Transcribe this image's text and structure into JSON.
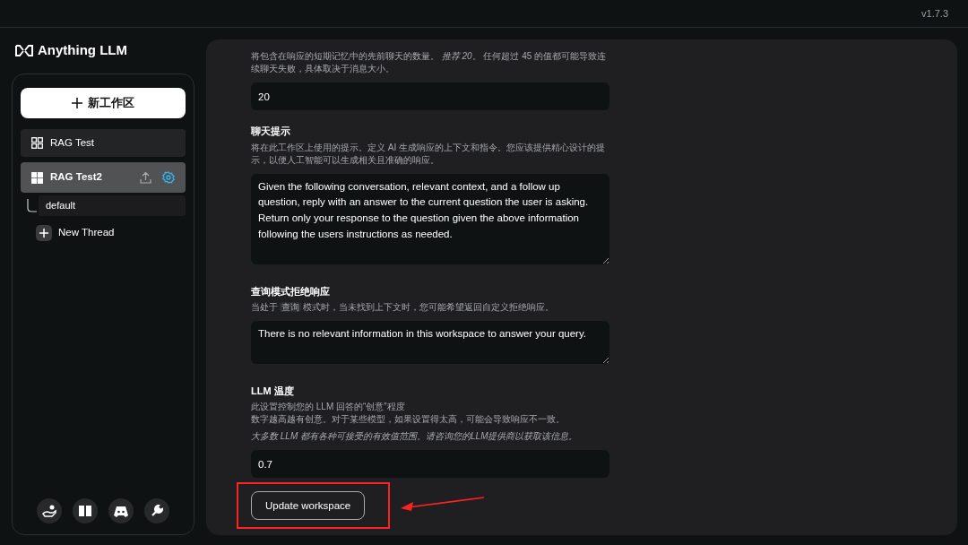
{
  "version": "v1.7.3",
  "brand": "Anything LLM",
  "sidebar": {
    "new_workspace": "新工作区",
    "workspaces": [
      {
        "name": "RAG Test",
        "selected": false
      },
      {
        "name": "RAG Test2",
        "selected": true,
        "threads": [
          {
            "name": "default"
          }
        ]
      }
    ],
    "new_thread": "New Thread"
  },
  "settings": [
    {
      "kind": "input",
      "description": [
        {
          "kind": "text",
          "text": "将包含在响应的短期记忆中的先前聊天的数量。 *推荐 20*。 任何超过 45 的值都可能导致连续聊天失败，具体取决于消息大小。"
        }
      ],
      "value": "20"
    },
    {
      "kind": "textarea",
      "label": "聊天提示",
      "description": [
        {
          "kind": "text",
          "text": "将在此工作区上使用的提示。定义 AI 生成响应的上下文和指令。您应该提供精心设计的提示，以便人工智能可以生成相关且准确的响应。"
        }
      ],
      "value": "Given the following conversation, relevant context, and a follow up question, reply with an answer to the current question the user is asking. Return only your response to the question given the above information following the users instructions as needed."
    },
    {
      "kind": "textarea",
      "label": "查询模式拒绝响应",
      "description": [
        {
          "kind": "text",
          "text": "当处于"
        },
        {
          "kind": "code",
          "text": "查询"
        },
        {
          "kind": "text",
          "text": "模式时，当未找到上下文时，您可能希望返回自定义拒绝响应。"
        }
      ],
      "value": "There is no relevant information in this workspace to answer your query."
    },
    {
      "kind": "input",
      "label": "LLM 温度",
      "description": [
        {
          "kind": "text",
          "text": "此设置控制您的 LLM 回答的“创意”程度"
        },
        {
          "kind": "line",
          "text": "数字越高越有创意。对于某些模型，如果设置得太高，可能会导致响应不一致。"
        },
        {
          "kind": "note",
          "text": "大多数 LLM 都有各种可接受的有效值范围。请咨询您的LLM提供商以获取该信息。"
        }
      ],
      "value": "0.7"
    }
  ],
  "update_button": "Update workspace"
}
